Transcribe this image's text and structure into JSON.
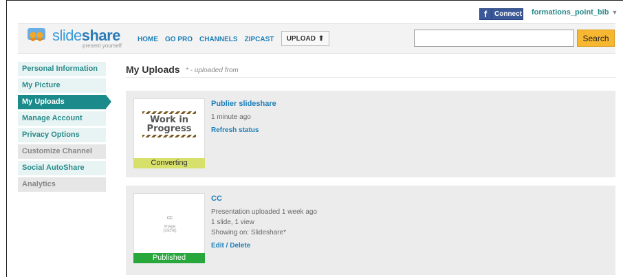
{
  "topbar": {
    "fb_connect": "Connect",
    "fb_icon": "f",
    "username": "formations_point_bib",
    "username_arrow": "▼"
  },
  "header": {
    "logo_text_prefix": "slide",
    "logo_text_suffix": "share",
    "logo_tagline": "present yourself",
    "nav": [
      "HOME",
      "GO PRO",
      "CHANNELS",
      "ZIPCAST"
    ],
    "upload_label": "UPLOAD",
    "upload_icon": "⬆",
    "search_placeholder": "",
    "search_button": "Search"
  },
  "sidebar": {
    "items": [
      {
        "label": "Personal Information"
      },
      {
        "label": "My Picture"
      },
      {
        "label": "My Uploads"
      },
      {
        "label": "Manage Account"
      },
      {
        "label": "Privacy Options"
      },
      {
        "label": "Customize Channel"
      },
      {
        "label": "Social AutoShare"
      },
      {
        "label": "Analytics"
      }
    ]
  },
  "main": {
    "title": "My Uploads",
    "subtitle": "* - uploaded from",
    "uploads": [
      {
        "title": "Publier slideshare",
        "time": "1 minute ago",
        "action": "Refresh status",
        "status": "Converting",
        "thumb_lines": [
          "Work in",
          "Progress"
        ]
      },
      {
        "title": "CC",
        "meta1": "Presentation uploaded 1 week ago",
        "meta2": "1 slide, 1 view",
        "meta3": "Showing on: Slideshare*",
        "edit": "Edit",
        "sep": " / ",
        "delete": "Delete",
        "status": "Published",
        "thumb_big": "cc",
        "thumb_small1": "image",
        "thumb_small2": "(cliché)"
      }
    ]
  },
  "colors": {
    "teal": "#1a8a8a",
    "link": "#1e7fb8",
    "search": "#f7b731",
    "converting": "#d6e06a",
    "published": "#28a73c"
  }
}
